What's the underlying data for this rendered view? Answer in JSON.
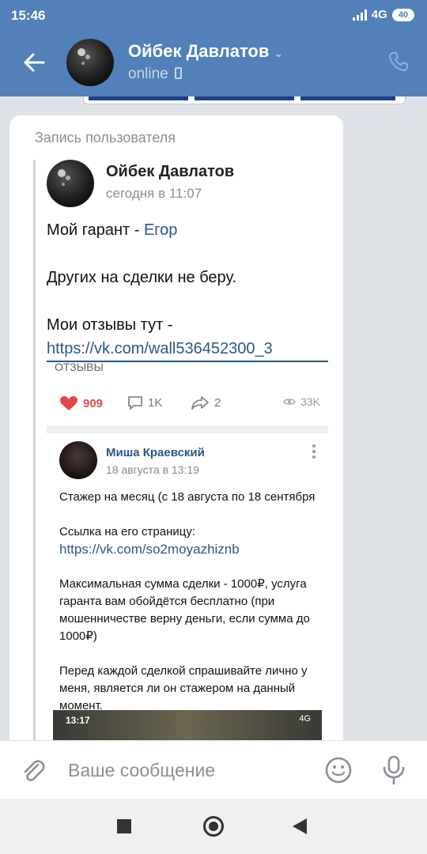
{
  "status_bar": {
    "time": "15:46",
    "network": "4G",
    "battery": "40"
  },
  "header": {
    "title": "Ойбек Давлатов",
    "subtitle": "online"
  },
  "message": {
    "repost_label": "Запись пользователя",
    "post": {
      "author": "Ойбек Давлатов",
      "date": "сегодня в 11:07",
      "line1_prefix": "Мой гарант - ",
      "line1_link": "Егор",
      "line2": "Других на сделки не беру.",
      "line3": "Мои отзывы тут -",
      "link": "https://vk.com/wall536452300_3"
    },
    "screenshot": {
      "cut_text": "ОТЗЫВЫ",
      "likes": "909",
      "comments": "1K",
      "shares": "2",
      "views": "33K",
      "comment_author": "Миша Краевский",
      "comment_date": "18 августа в 13:19",
      "c_line1": "Стажер на месяц (с 18 августа по 18 сентября",
      "c_line2": "Ссылка на его страницу:",
      "c_link": "https://vk.com/so2moyazhiznb",
      "c_line3": "Максимальная сумма сделки - 1000₽, услуга гаранта вам обойдётся бесплатно (при мошенничестве верну деньги, если сумма до 1000₽)",
      "c_line4": "Перед каждой сделкой спрашивайте лично у меня, является ли он стажером на данный момент.",
      "inner_time": "13:17",
      "inner_net": "4G"
    }
  },
  "composer": {
    "placeholder": "Ваше сообщение"
  },
  "colors": {
    "brand": "#5181b8",
    "link": "#2a5885",
    "like": "#e64646"
  }
}
